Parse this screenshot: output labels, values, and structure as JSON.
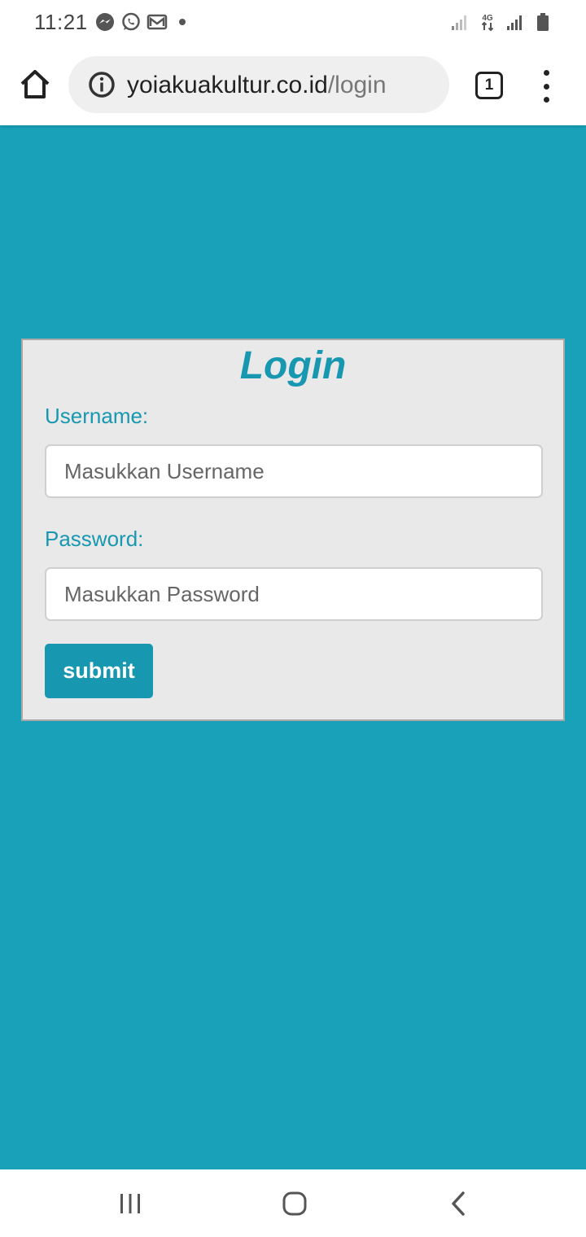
{
  "status_bar": {
    "time": "11:21",
    "left_icons": [
      "messenger-icon",
      "whatsapp-icon",
      "gmail-icon",
      "notification-dot"
    ],
    "right_icons": [
      "signal-icon",
      "network-4g-icon",
      "signal-icon",
      "battery-icon"
    ],
    "network_label": "4G"
  },
  "browser": {
    "url_domain": "yoiakuakultur.co.id",
    "url_path": "/login",
    "tab_count": "1"
  },
  "login": {
    "title": "Login",
    "username_label": "Username:",
    "username_placeholder": "Masukkan Username",
    "username_value": "",
    "password_label": "Password:",
    "password_placeholder": "Masukkan Password",
    "password_value": "",
    "submit_label": "submit"
  },
  "nav_bar": {
    "buttons": [
      "recent-apps",
      "home",
      "back"
    ]
  },
  "colors": {
    "page_background": "#18a1b8",
    "accent": "#1898b0",
    "card_background": "#e9e9e9"
  }
}
